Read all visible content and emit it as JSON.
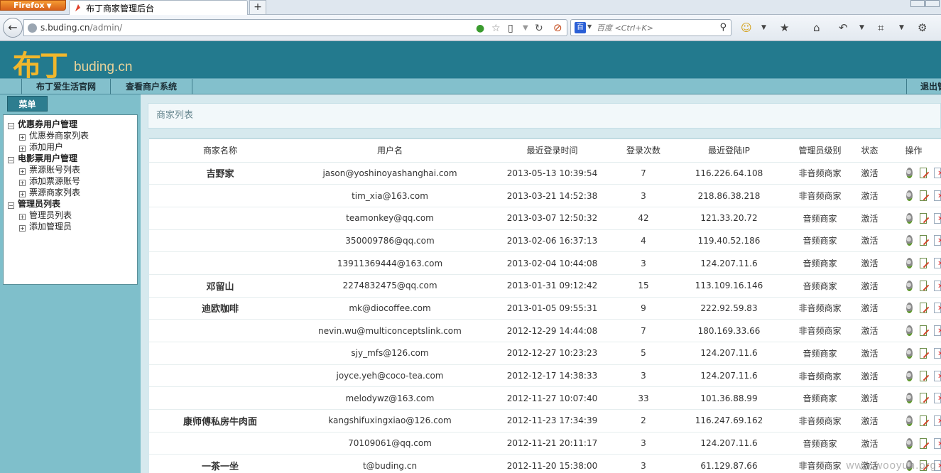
{
  "browser": {
    "menu_button": "Firefox",
    "tab_title": "布丁商家管理后台",
    "new_tab": "+",
    "url_domain": "s.buding.cn",
    "url_path": "/admin/",
    "search_placeholder": "百度 <Ctrl+K>",
    "search_engine": "百"
  },
  "site": {
    "logo_cn": "布丁",
    "logo_en": "buding.cn",
    "nav": [
      "布丁爱生活官网",
      "查看商户系统"
    ],
    "logout": "退出管"
  },
  "sidebar": {
    "menu_tab": "菜单",
    "groups": [
      {
        "label": "优惠券用户管理",
        "items": [
          "优惠券商家列表",
          "添加用户"
        ]
      },
      {
        "label": "电影票用户管理",
        "items": [
          "票源账号列表",
          "添加票源账号",
          "票源商家列表"
        ]
      },
      {
        "label": "管理员列表",
        "items": [
          "管理员列表",
          "添加管理员"
        ]
      }
    ]
  },
  "content": {
    "title": "商家列表",
    "columns": [
      "商家名称",
      "用户名",
      "最近登录时间",
      "登录次数",
      "最近登陆IP",
      "管理员级别",
      "状态",
      "操作"
    ],
    "rows": [
      [
        "吉野家",
        "jason@yoshinoyashanghai.com",
        "2013-05-13 10:39:54",
        "7",
        "116.226.64.108",
        "非音频商家",
        "激活"
      ],
      [
        "",
        "tim_xia@163.com",
        "2013-03-21 14:52:38",
        "3",
        "218.86.38.218",
        "非音频商家",
        "激活"
      ],
      [
        "",
        "teamonkey@qq.com",
        "2013-03-07 12:50:32",
        "42",
        "121.33.20.72",
        "音频商家",
        "激活"
      ],
      [
        "",
        "350009786@qq.com",
        "2013-02-06 16:37:13",
        "4",
        "119.40.52.186",
        "音频商家",
        "激活"
      ],
      [
        "",
        "13911369444@163.com",
        "2013-02-04 10:44:08",
        "3",
        "124.207.11.6",
        "音频商家",
        "激活"
      ],
      [
        "邓留山",
        "2274832475@qq.com",
        "2013-01-31 09:12:42",
        "15",
        "113.109.16.146",
        "音频商家",
        "激活"
      ],
      [
        "迪欧咖啡",
        "mk@diocoffee.com",
        "2013-01-05 09:55:31",
        "9",
        "222.92.59.83",
        "非音频商家",
        "激活"
      ],
      [
        "",
        "nevin.wu@multiconceptslink.com",
        "2012-12-29 14:44:08",
        "7",
        "180.169.33.66",
        "非音频商家",
        "激活"
      ],
      [
        "",
        "sjy_mfs@126.com",
        "2012-12-27 10:23:23",
        "5",
        "124.207.11.6",
        "音频商家",
        "激活"
      ],
      [
        "",
        "joyce.yeh@coco-tea.com",
        "2012-12-17 14:38:33",
        "3",
        "124.207.11.6",
        "非音频商家",
        "激活"
      ],
      [
        "",
        "melodywz@163.com",
        "2012-11-27 10:07:40",
        "33",
        "101.36.88.99",
        "音频商家",
        "激活"
      ],
      [
        "康师傅私房牛肉面",
        "kangshifuxingxiao@126.com",
        "2012-11-23 17:34:39",
        "2",
        "116.247.69.162",
        "非音频商家",
        "激活"
      ],
      [
        "",
        "70109061@qq.com",
        "2012-11-21 20:11:17",
        "3",
        "124.207.11.6",
        "音频商家",
        "激活"
      ],
      [
        "一茶一坐",
        "t@buding.cn",
        "2012-11-20 15:38:00",
        "3",
        "61.129.87.66",
        "非音频商家",
        "激活"
      ]
    ]
  },
  "watermark": "www.wooyun.org",
  "colors": {
    "header": "#237a8e",
    "nav": "#83c0cc",
    "logo": "#f1b72c"
  }
}
